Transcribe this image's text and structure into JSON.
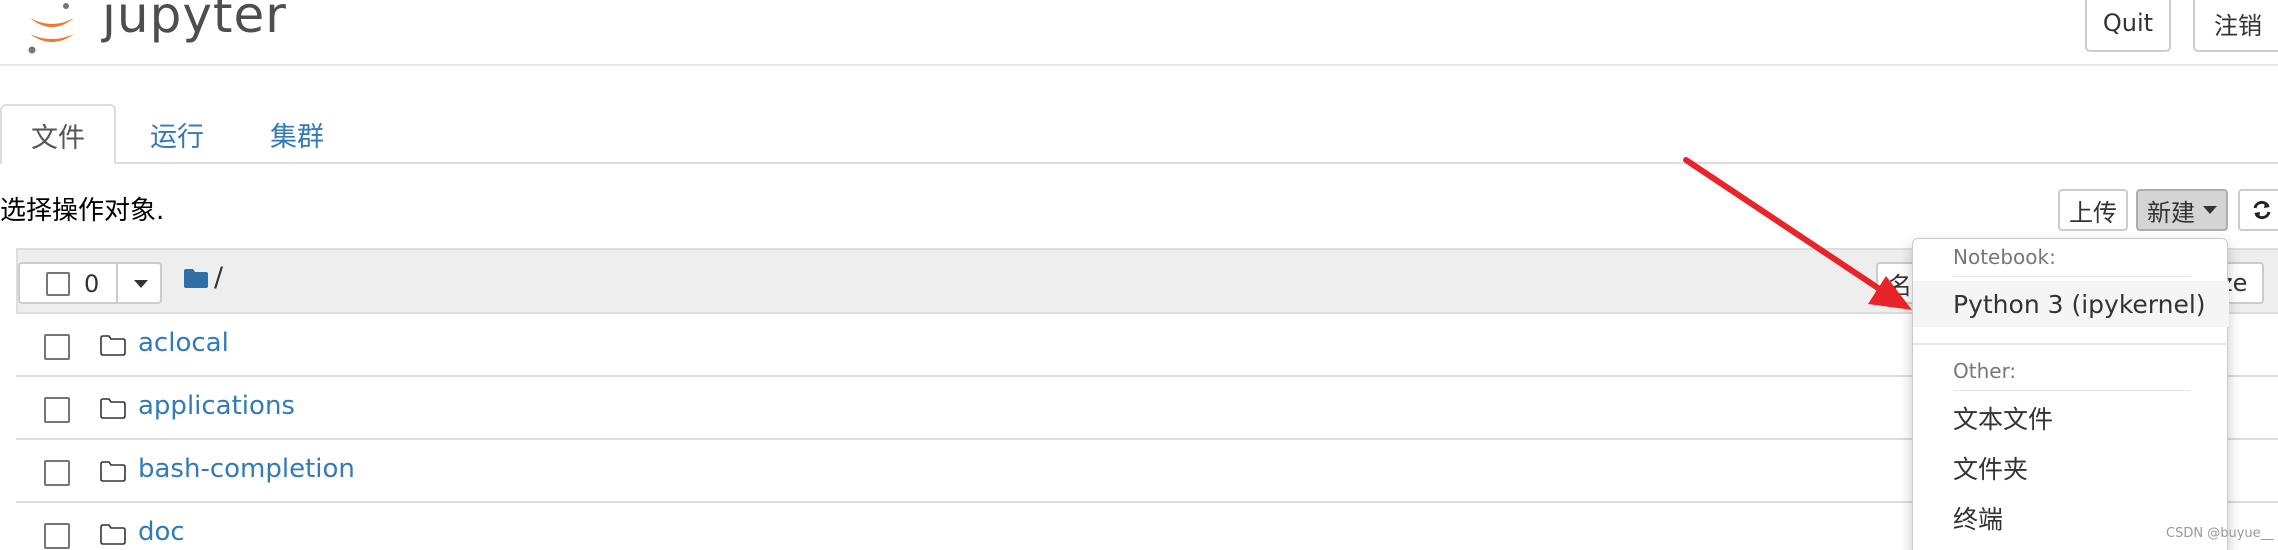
{
  "header": {
    "logo_text": "jupyter",
    "quit_label": "Quit",
    "logout_label": "注销"
  },
  "tabs": [
    {
      "label": "文件",
      "active": true
    },
    {
      "label": "运行",
      "active": false
    },
    {
      "label": "集群",
      "active": false
    }
  ],
  "toolbar": {
    "select_message": "选择操作对象.",
    "upload_label": "上传",
    "new_label": "新建"
  },
  "list_header": {
    "selected_count": "0",
    "breadcrumb_root": "/",
    "name_sort_partial": "名",
    "filesize_partial": "ze"
  },
  "files": [
    {
      "name": "aclocal"
    },
    {
      "name": "applications"
    },
    {
      "name": "bash-completion"
    },
    {
      "name": "doc"
    }
  ],
  "new_menu": {
    "notebook_header": "Notebook:",
    "notebook_items": [
      "Python 3 (ipykernel)"
    ],
    "other_header": "Other:",
    "other_items": [
      "文本文件",
      "文件夹",
      "终端"
    ]
  },
  "annotation": {
    "arrow_color": "#e8232a"
  },
  "watermark": "CSDN @buyue__",
  "colors": {
    "link": "#337ab7",
    "logo_orange": "#f37726"
  }
}
